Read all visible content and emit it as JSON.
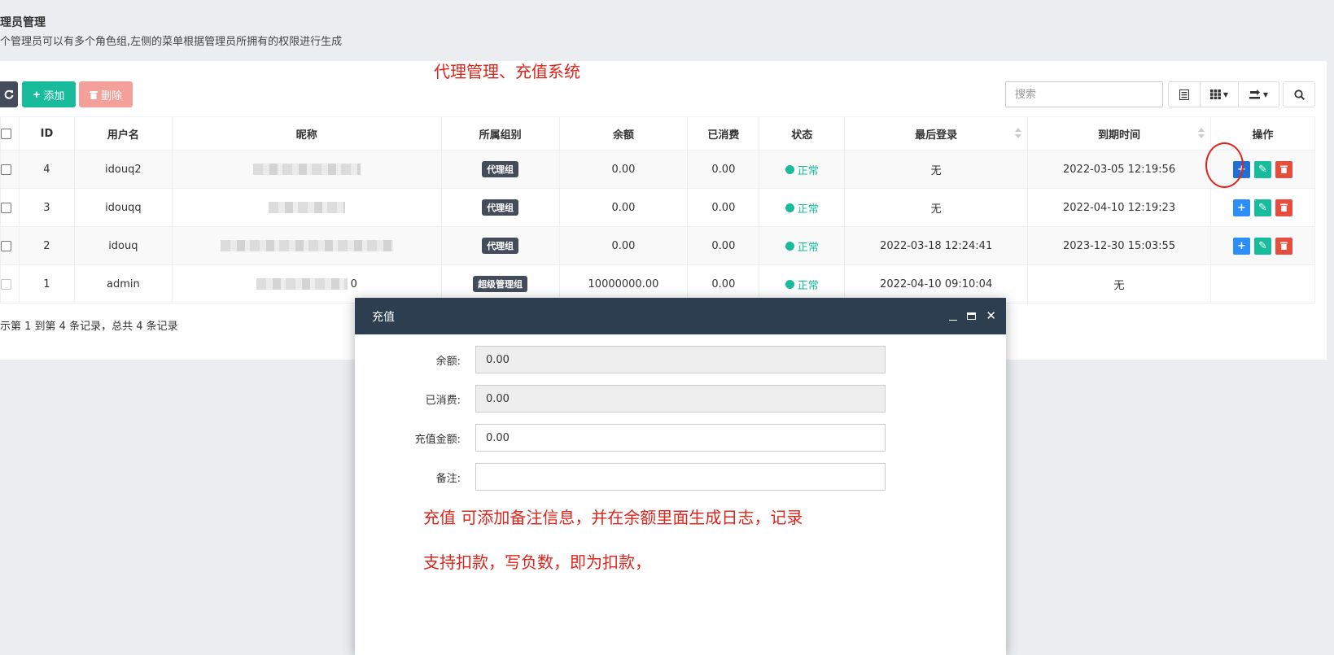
{
  "header": {
    "title": "理员管理",
    "description": "个管理员可以有多个角色组,左侧的菜单根据管理员所拥有的权限进行生成"
  },
  "annotations": {
    "top": "代理管理、充值系统",
    "dialog_line1": "充值 可添加备注信息，并在余额里面生成日志，记录",
    "dialog_line2": "支持扣款，写负数，即为扣款，"
  },
  "toolbar": {
    "add_label": "添加",
    "delete_label": "删除",
    "search_placeholder": "搜索"
  },
  "table": {
    "columns": [
      "ID",
      "用户名",
      "昵称",
      "所属组别",
      "余额",
      "已消费",
      "状态",
      "最后登录",
      "到期时间",
      "操作"
    ],
    "rows": [
      {
        "id": "4",
        "username": "idouq2",
        "nickname": "",
        "group": "代理组",
        "balance": "0.00",
        "consumed": "0.00",
        "status": "正常",
        "last_login": "无",
        "expire": "2022-03-05 12:19:56"
      },
      {
        "id": "3",
        "username": "idouqq",
        "nickname": "",
        "group": "代理组",
        "balance": "0.00",
        "consumed": "0.00",
        "status": "正常",
        "last_login": "无",
        "expire": "2022-04-10 12:19:23"
      },
      {
        "id": "2",
        "username": "idouq",
        "nickname": "",
        "group": "代理组",
        "balance": "0.00",
        "consumed": "0.00",
        "status": "正常",
        "last_login": "2022-03-18 12:24:41",
        "expire": "2023-12-30 15:03:55"
      },
      {
        "id": "1",
        "username": "admin",
        "nickname": "0",
        "group": "超级管理组",
        "balance": "10000000.00",
        "consumed": "0.00",
        "status": "正常",
        "last_login": "2022-04-10 09:10:04",
        "expire": "无"
      }
    ]
  },
  "pagination": {
    "summary": "示第 1 到第 4 条记录，总共 4 条记录"
  },
  "dialog": {
    "title": "充值",
    "fields": [
      {
        "label": "余额:",
        "value": "0.00"
      },
      {
        "label": "已消费:",
        "value": "0.00"
      },
      {
        "label": "充值金额:",
        "value": "0.00"
      },
      {
        "label": "备注:",
        "value": ""
      }
    ]
  },
  "colors": {
    "primary": "#2c8ef8",
    "success": "#18bc9c",
    "danger": "#e74c3c",
    "dark": "#444c5c",
    "dialog_header": "#2c3e50",
    "annotation": "#e0241b"
  },
  "icons": [
    "refresh-icon",
    "plus-icon",
    "trash-icon",
    "list-icon",
    "columns-icon",
    "export-icon",
    "search-icon",
    "pencil-icon",
    "minimize-icon",
    "maximize-icon",
    "close-icon"
  ]
}
